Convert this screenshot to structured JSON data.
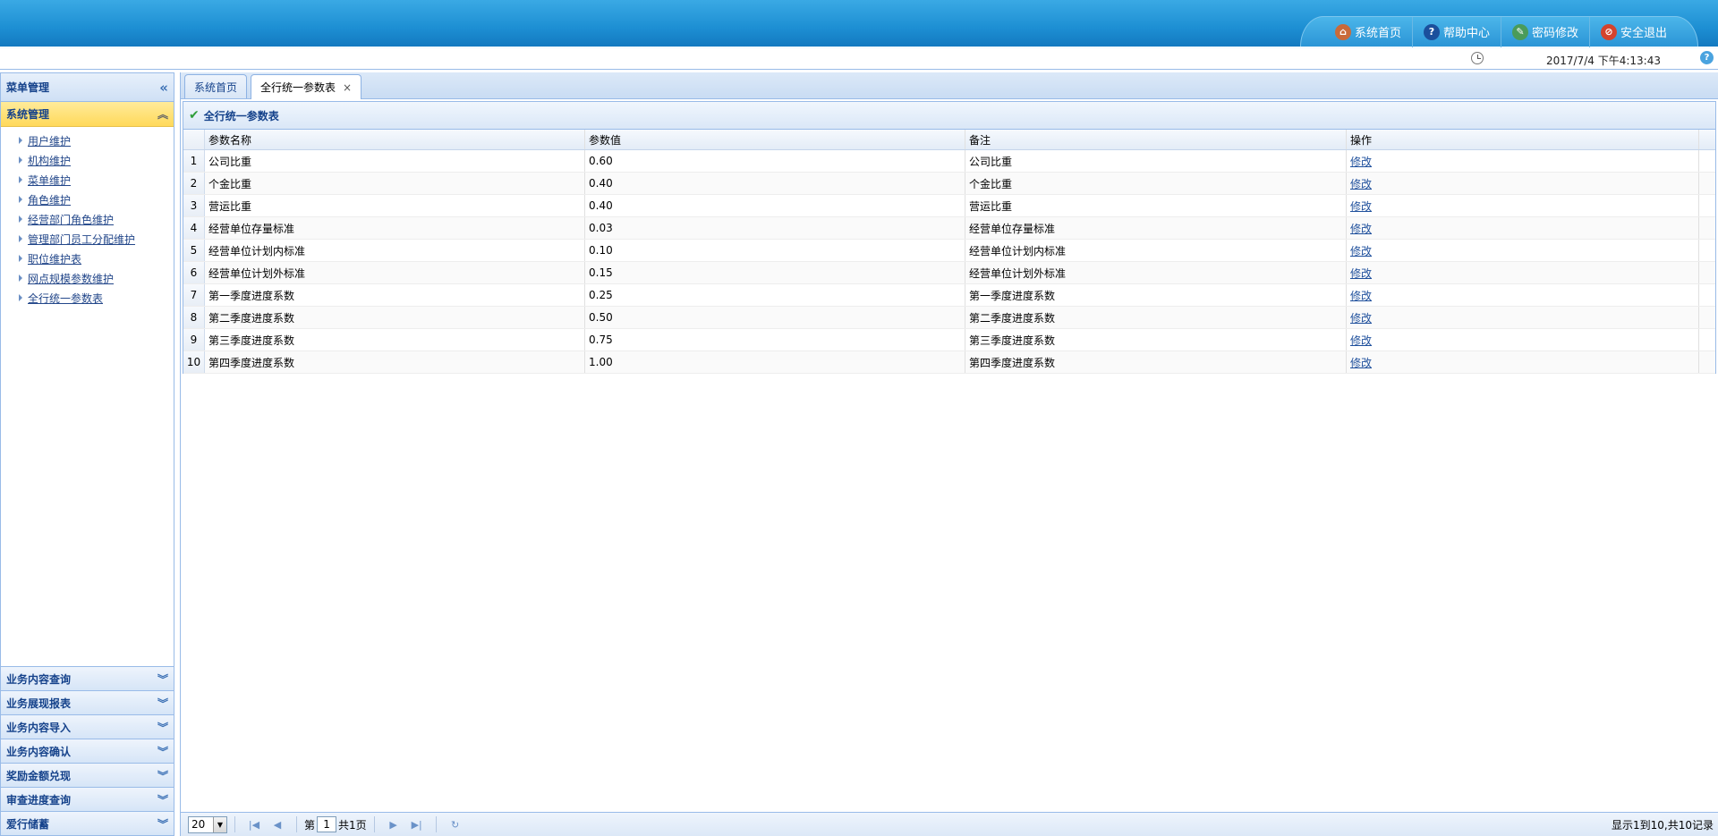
{
  "topnav": {
    "items": [
      {
        "label": "系统首页",
        "icon": "home-icon"
      },
      {
        "label": "帮助中心",
        "icon": "help-icon"
      },
      {
        "label": "密码修改",
        "icon": "key-icon"
      },
      {
        "label": "安全退出",
        "icon": "logout-icon"
      }
    ]
  },
  "infobar": {
    "datetime": "2017/7/4 下午4:13:43"
  },
  "sidebar": {
    "title": "菜单管理",
    "active_group": "系统管理",
    "tree_items": [
      "用户维护",
      "机构维护",
      "菜单维护",
      "角色维护",
      "经营部门角色维护",
      "管理部门员工分配维护",
      "职位维护表",
      "网点规模参数维护",
      "全行统一参数表"
    ],
    "groups": [
      "业务内容查询",
      "业务展现报表",
      "业务内容导入",
      "业务内容确认",
      "奖励金额兑现",
      "审查进度查询",
      "爱行储蓄"
    ]
  },
  "tabs": [
    {
      "label": "系统首页",
      "active": false
    },
    {
      "label": "全行统一参数表",
      "active": true
    }
  ],
  "panel": {
    "title": "全行统一参数表"
  },
  "grid": {
    "columns": [
      "参数名称",
      "参数值",
      "备注",
      "操作"
    ],
    "action_label": "修改",
    "rows": [
      {
        "num": "1",
        "name": "公司比重",
        "value": "0.60",
        "note": "公司比重"
      },
      {
        "num": "2",
        "name": "个金比重",
        "value": "0.40",
        "note": "个金比重"
      },
      {
        "num": "3",
        "name": "营运比重",
        "value": "0.40",
        "note": "营运比重"
      },
      {
        "num": "4",
        "name": "经营单位存量标准",
        "value": "0.03",
        "note": "经营单位存量标准"
      },
      {
        "num": "5",
        "name": "经营单位计划内标准",
        "value": "0.10",
        "note": "经营单位计划内标准"
      },
      {
        "num": "6",
        "name": "经营单位计划外标准",
        "value": "0.15",
        "note": "经营单位计划外标准"
      },
      {
        "num": "7",
        "name": "第一季度进度系数",
        "value": "0.25",
        "note": "第一季度进度系数"
      },
      {
        "num": "8",
        "name": "第二季度进度系数",
        "value": "0.50",
        "note": "第二季度进度系数"
      },
      {
        "num": "9",
        "name": "第三季度进度系数",
        "value": "0.75",
        "note": "第三季度进度系数"
      },
      {
        "num": "10",
        "name": "第四季度进度系数",
        "value": "1.00",
        "note": "第四季度进度系数"
      }
    ]
  },
  "pager": {
    "page_size": "20",
    "page_prefix": "第",
    "current_page": "1",
    "page_suffix": "共1页",
    "summary": "显示1到10,共10记录"
  },
  "colors": {
    "banner": "#1d8fd3",
    "active_group": "#ffd95a",
    "border": "#99bbe8",
    "link": "#1e4f9c"
  }
}
